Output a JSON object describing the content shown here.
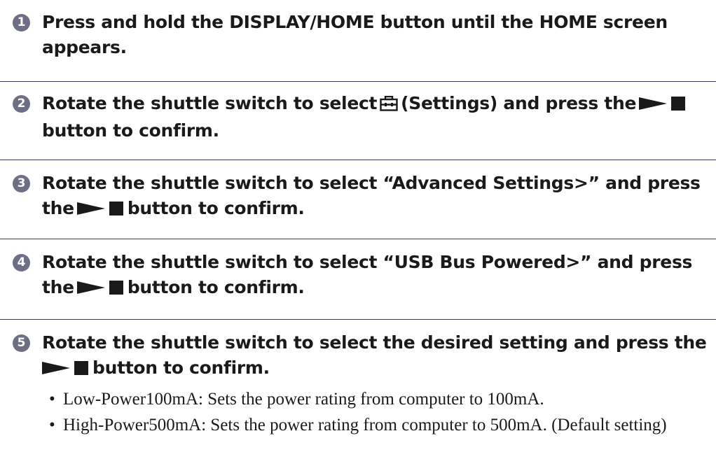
{
  "steps": [
    {
      "number": "1",
      "text": "Press and hold the DISPLAY/HOME button until the HOME screen appears."
    },
    {
      "number": "2",
      "text_before": "Rotate the shuttle switch to select",
      "icon": "settings-toolbox-icon",
      "text_middle": "(Settings) and press the",
      "button_icon": "play-stop-icon",
      "text_after": "button to confirm."
    },
    {
      "number": "3",
      "text_before": "Rotate the shuttle switch to select “Advanced Settings>” and press the",
      "button_icon": "play-stop-icon",
      "text_after": "button to confirm."
    },
    {
      "number": "4",
      "text_before": "Rotate the shuttle switch to select “USB Bus Powered>” and press the",
      "button_icon": "play-stop-icon",
      "text_after": "button to confirm."
    },
    {
      "number": "5",
      "text_before": "Rotate the shuttle switch to select the desired setting and press the",
      "button_icon": "play-stop-icon",
      "text_after": "button to confirm.",
      "options": [
        {
          "bullet": "•",
          "text": "Low-Power100mA: Sets the power rating from computer to 100mA."
        },
        {
          "bullet": "•",
          "text": "High-Power500mA: Sets the power rating from computer to 500mA. (Default setting)"
        }
      ]
    }
  ],
  "colors": {
    "number_badge": "#6e6e85",
    "divider": "#3c3c5a",
    "text": "#1a1a1a"
  }
}
